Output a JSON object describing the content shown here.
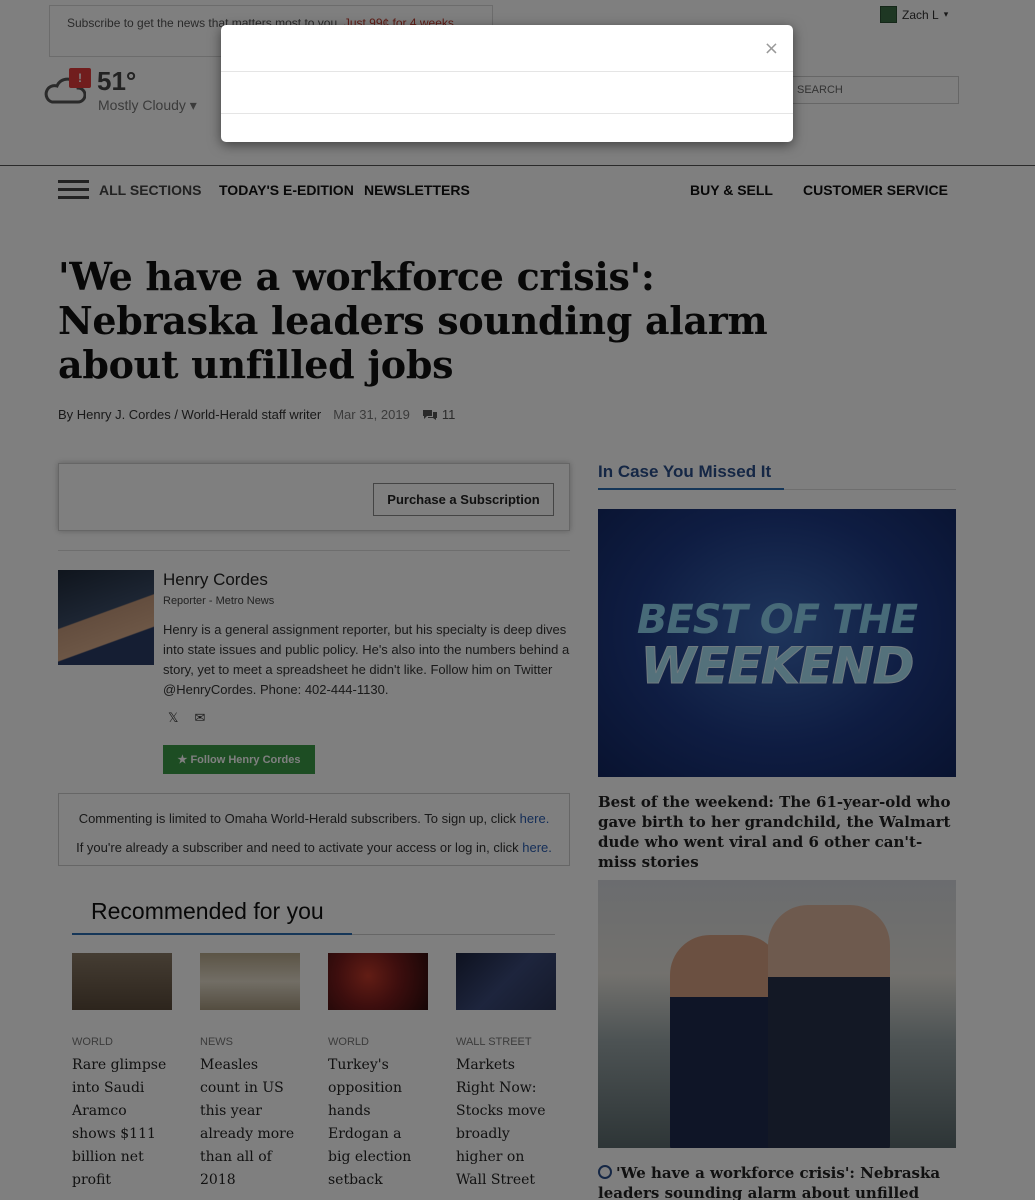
{
  "header": {
    "subscribe_text": "Subscribe to get the news that matters most to you.",
    "subscribe_price": "Just 99¢ for 4 weeks",
    "user_name": "Zach L",
    "user_caret": "▾",
    "weather_alert": "!",
    "temperature": "51°",
    "conditions": "Mostly Cloudy ▾",
    "search_placeholder": "SEARCH"
  },
  "nav": {
    "all_sections": "ALL SECTIONS",
    "edition": "TODAY'S E-EDITION",
    "newsletters": "NEWSLETTERS",
    "buy_sell": "BUY & SELL",
    "customer_service": "CUSTOMER SERVICE"
  },
  "article": {
    "headline": "'We have a workforce crisis': Nebraska leaders sounding alarm about unfilled jobs",
    "byline": "By Henry J. Cordes / World-Herald staff writer",
    "date": "Mar 31, 2019",
    "comment_count": "11",
    "purchase_button": "Purchase a Subscription"
  },
  "author": {
    "name": "Henry Cordes",
    "role": "Reporter - Metro News",
    "bio": "Henry is a general assignment reporter, but his specialty is deep dives into state issues and public policy. He's also into the numbers behind a story, yet to meet a spreadsheet he didn't like. Follow him on Twitter @HenryCordes. Phone: 402-444-1130.",
    "twitter_icon": "𝕏",
    "email_icon": "✉",
    "follow_button": "★ Follow Henry Cordes"
  },
  "comments": {
    "line1": "Commenting is limited to Omaha World-Herald subscribers. To sign up, click",
    "line1_link": "here.",
    "line2": "If you're already a subscriber and need to activate your access or log in, click",
    "line2_link": "here."
  },
  "recommended": {
    "title": "Recommended for you",
    "items": [
      {
        "category": "WORLD",
        "headline": "Rare glimpse into Saudi Aramco shows $111 billion net profit",
        "thumb_color": "#5a4a3a"
      },
      {
        "category": "NEWS",
        "headline": "Measles count in US this year already more than all of 2018",
        "thumb_color": "#b8a98c"
      },
      {
        "category": "WORLD",
        "headline": "Turkey's opposition hands Erdogan a big election setback",
        "thumb_color": "#7a1c1c"
      },
      {
        "category": "WALL STREET",
        "headline": "Markets Right Now: Stocks move broadly higher on Wall Street",
        "thumb_color": "#2a3456"
      }
    ]
  },
  "sidebar": {
    "title": "In Case You Missed It",
    "image1_line1": "BEST OF THE",
    "image1_line2": "WEEKEND",
    "caption1": "Best of the weekend: The 61-year-old who gave birth to her grandchild, the Walmart dude who went viral and 6 other can't-miss stories",
    "caption2": "'We have a workforce crisis': Nebraska leaders sounding alarm about unfilled jobs"
  },
  "modal": {
    "close_label": "×"
  }
}
